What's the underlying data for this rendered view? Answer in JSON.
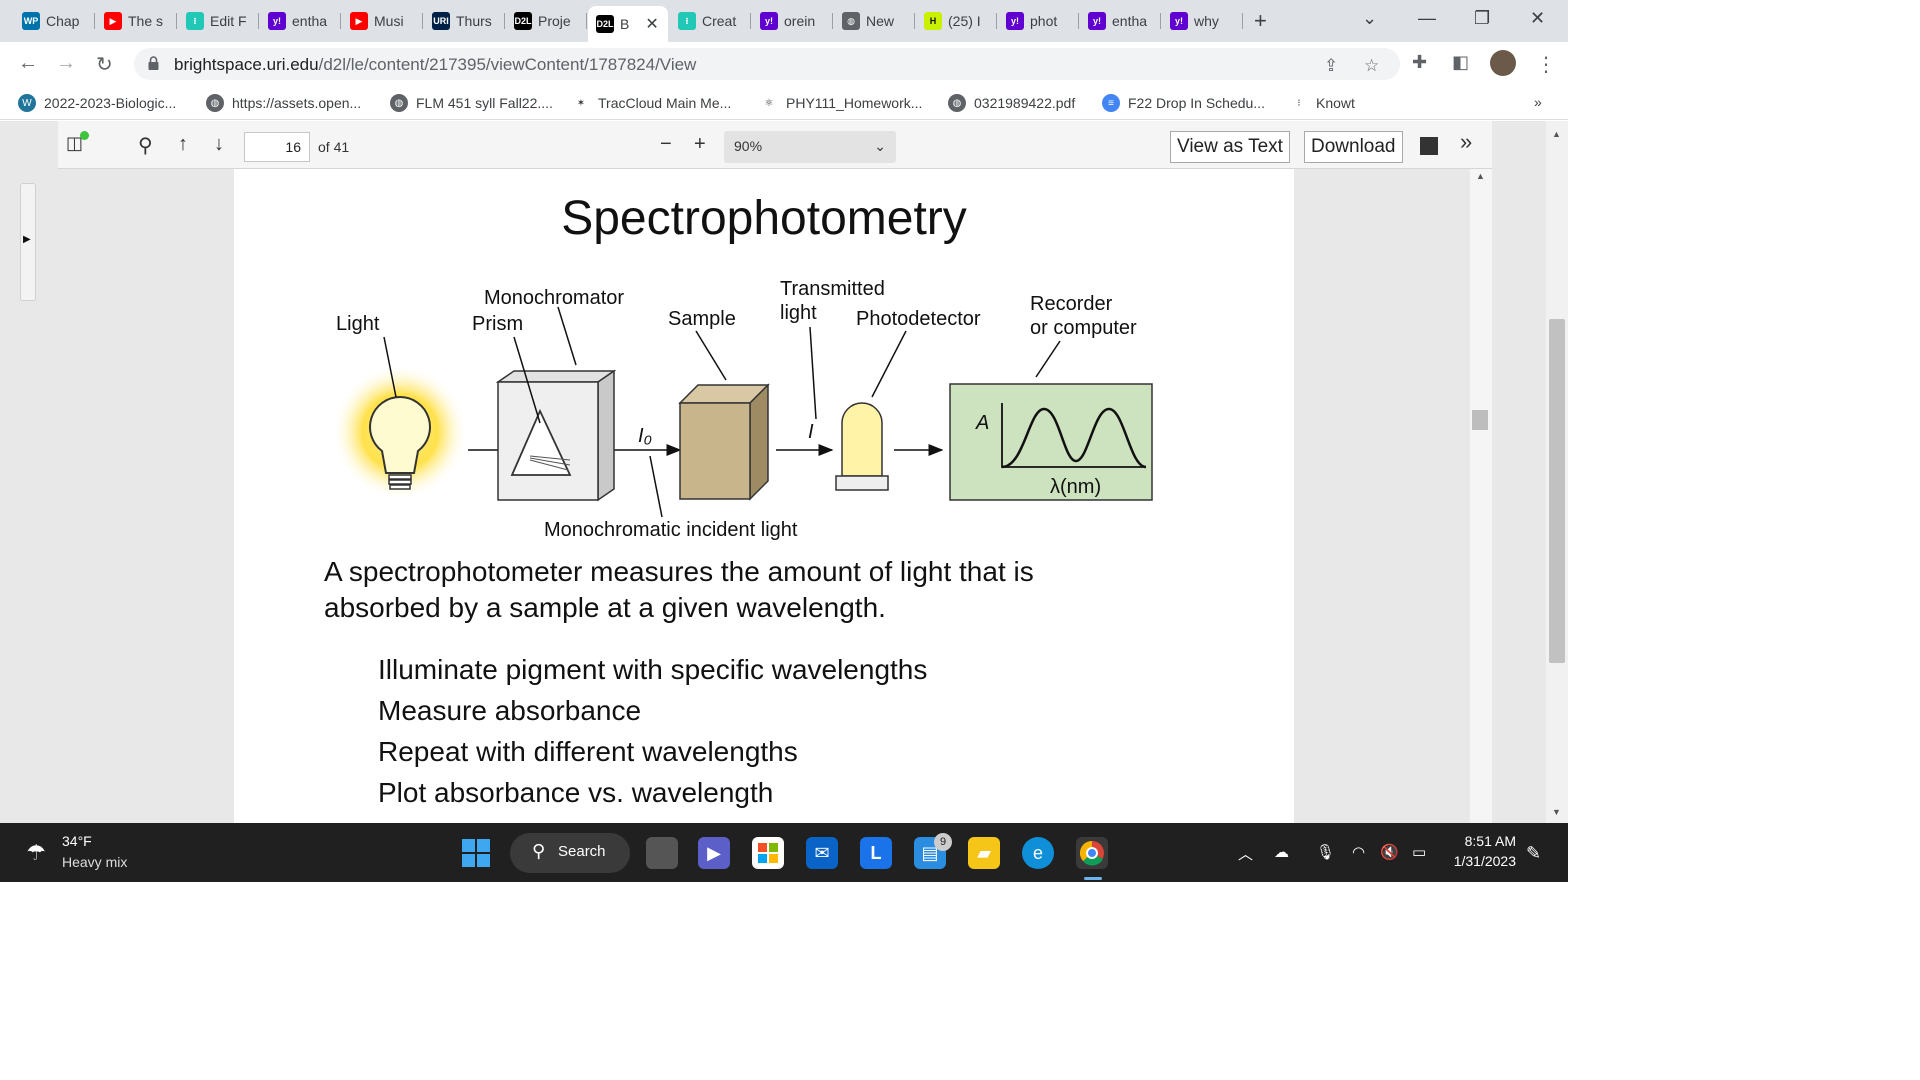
{
  "tabs": [
    {
      "label": "Chap",
      "icon": "wp-icon",
      "color": "#0073aa",
      "glyph": "WP"
    },
    {
      "label": "The s",
      "icon": "youtube-icon",
      "color": "#ff0000",
      "glyph": "▶"
    },
    {
      "label": "Edit F",
      "icon": "knowt-icon",
      "color": "#21c8b6",
      "glyph": "⁝"
    },
    {
      "label": "entha",
      "icon": "yahoo-icon",
      "color": "#6001d2",
      "glyph": "y!"
    },
    {
      "label": "Musi",
      "icon": "youtube-icon",
      "color": "#ff0000",
      "glyph": "▶"
    },
    {
      "label": "Thurs",
      "icon": "uri-icon",
      "color": "#002147",
      "glyph": "URI"
    },
    {
      "label": "Proje",
      "icon": "d2l-icon",
      "color": "#000000",
      "glyph": "D2L"
    },
    {
      "label": "B",
      "icon": "d2l-icon",
      "color": "#000000",
      "glyph": "D2L",
      "active": true
    },
    {
      "label": "Creat",
      "icon": "knowt-icon",
      "color": "#21c8b6",
      "glyph": "⁝"
    },
    {
      "label": "orein",
      "icon": "yahoo-icon",
      "color": "#6001d2",
      "glyph": "y!"
    },
    {
      "label": "New",
      "icon": "globe-icon",
      "color": "#5f6368",
      "glyph": "◍"
    },
    {
      "label": "(25) I",
      "icon": "h-icon",
      "color": "#c8f000",
      "glyph": "H"
    },
    {
      "label": "phot",
      "icon": "yahoo-icon",
      "color": "#6001d2",
      "glyph": "y!"
    },
    {
      "label": "entha",
      "icon": "yahoo-icon",
      "color": "#6001d2",
      "glyph": "y!"
    },
    {
      "label": "why",
      "icon": "yahoo-icon",
      "color": "#6001d2",
      "glyph": "y!"
    }
  ],
  "address": {
    "host": "brightspace.uri.edu",
    "path": "/d2l/le/content/217395/viewContent/1787824/View"
  },
  "bookmarks": [
    {
      "label": "2022-2023-Biologic...",
      "icon": "wordpress-icon"
    },
    {
      "label": "https://assets.open...",
      "icon": "globe-icon"
    },
    {
      "label": "FLM 451 syll Fall22....",
      "icon": "globe-icon"
    },
    {
      "label": "TracCloud Main Me...",
      "icon": "traccloud-icon"
    },
    {
      "label": "PHY111_Homework...",
      "icon": "physics-icon"
    },
    {
      "label": "0321989422.pdf",
      "icon": "globe-icon"
    },
    {
      "label": "F22 Drop In Schedu...",
      "icon": "docs-icon"
    },
    {
      "label": "Knowt",
      "icon": "knowt-icon"
    }
  ],
  "bookmarks_more": "»",
  "pdf_toolbar": {
    "page_current": "16",
    "page_total_label": "of 41",
    "zoom": "90%",
    "view_as_text": "View as Text",
    "download": "Download",
    "more": "»"
  },
  "slide": {
    "title": "Spectrophotometry",
    "diagram_labels": {
      "light": "Light",
      "monochromator": "Monochromator",
      "prism": "Prism",
      "sample": "Sample",
      "transmitted_1": "Transmitted",
      "transmitted_2": "light",
      "photodetector": "Photodetector",
      "recorder_1": "Recorder",
      "recorder_2": "or computer",
      "i0": "I₀",
      "i": "I",
      "axis_a": "A",
      "axis_lambda": "λ(nm)",
      "monochromatic": "Monochromatic incident light"
    },
    "description": "A spectrophotometer measures the amount of light that is absorbed by a sample at a given wavelength.",
    "bullets": [
      "Illuminate pigment with specific wavelengths",
      "Measure absorbance",
      "Repeat with different wavelengths",
      "Plot absorbance vs. wavelength"
    ]
  },
  "taskbar": {
    "temperature": "34°F",
    "weather": "Heavy mix",
    "search": "Search",
    "time": "8:51 AM",
    "date": "1/31/2023",
    "mail_badge": "9"
  }
}
